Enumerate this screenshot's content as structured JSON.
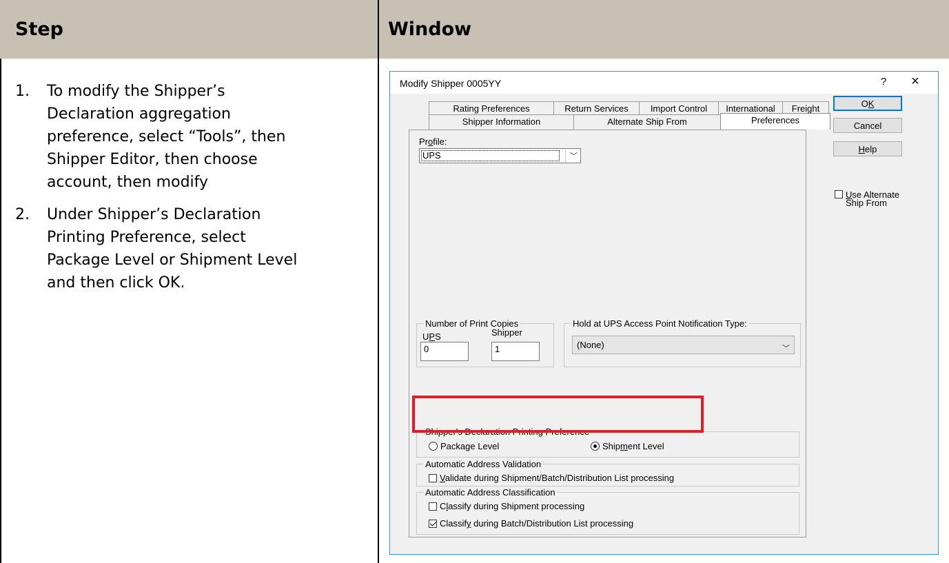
{
  "table": {
    "header_step": "Step",
    "header_window": "Window"
  },
  "steps": [
    {
      "number": "1.",
      "lines": [
        "To modify the Shipper’s",
        "Declaration aggregation",
        "preference, select “Tools”, then",
        "Shipper Editor, then choose",
        "account, then modify"
      ]
    },
    {
      "number": "2.",
      "lines": [
        "Under Shipper’s Declaration",
        "Printing Preference, select",
        "Package Level or Shipment Level",
        "and then click OK."
      ]
    }
  ],
  "dialog": {
    "title": "Modify Shipper 0005YY",
    "help_glyph": "?",
    "close_glyph": "×",
    "tabs_back": [
      "Rating Preferences",
      "Return Services",
      "Import Control",
      "International",
      "Freight"
    ],
    "tabs_front": [
      "Shipper Information",
      "Alternate Ship From",
      "Preferences"
    ],
    "active_tab": "Preferences",
    "buttons": {
      "ok": "OK",
      "cancel": "Cancel",
      "help": "Help"
    },
    "use_alternate": {
      "label_line1": "Use Alternate",
      "label_line2": "Ship From",
      "checked": false
    },
    "profile": {
      "label": "Profile:",
      "value": "UPS"
    },
    "print_copies": {
      "title": "Number of Print Copies",
      "ups_label": "UPS",
      "shipper_label": "Shipper",
      "ups_value": "0",
      "shipper_value": "1"
    },
    "hold_at": {
      "title": "Hold at UPS Access Point Notification Type:",
      "value": "(None)"
    },
    "declaration_pref": {
      "title": "Shipper's Declaration Printing Preference",
      "option_package": "Package Level",
      "option_shipment": "Shipment Level",
      "selected": "Shipment Level"
    },
    "address_validation": {
      "title": "Automatic Address Validation",
      "option": "Validate during Shipment/Batch/Distribution List processing",
      "checked": false
    },
    "address_classification": {
      "title": "Automatic Address Classification",
      "option1": "Classify during Shipment processing",
      "option1_checked": false,
      "option2": "Classify during Batch/Distribution List processing",
      "option2_checked": true
    },
    "highlight_color": "#e11d2b"
  }
}
